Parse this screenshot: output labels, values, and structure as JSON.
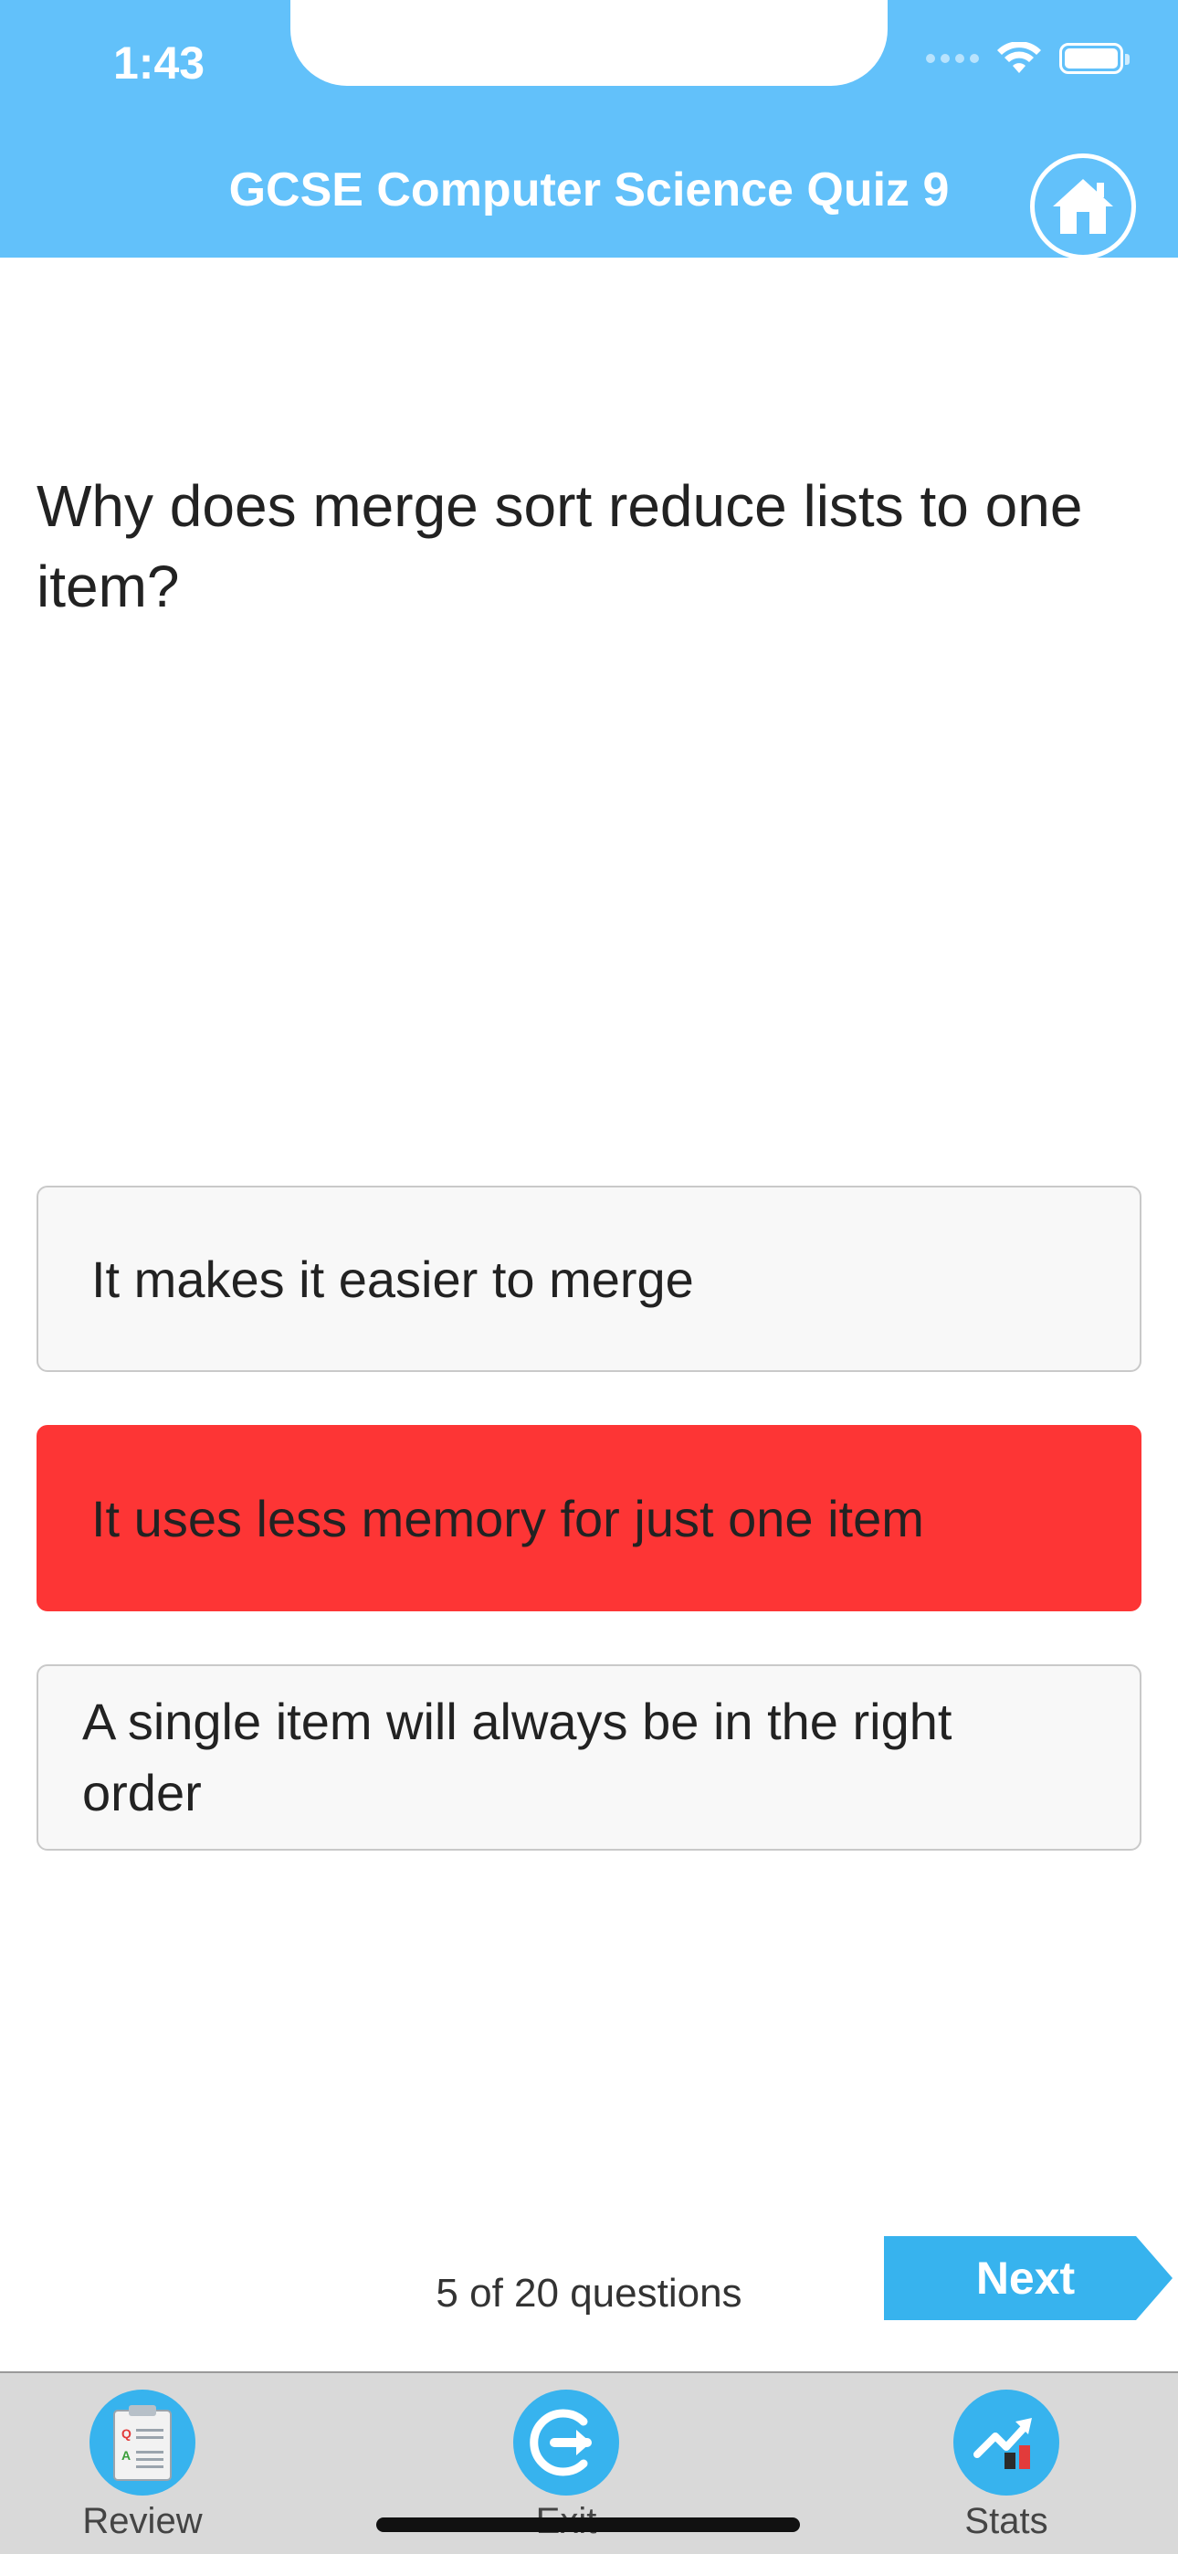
{
  "status_bar": {
    "time": "1:43"
  },
  "header": {
    "title": "GCSE Computer Science Quiz 9"
  },
  "question": {
    "text": "Why does merge sort reduce lists to one item?"
  },
  "answers": [
    {
      "text": "It makes it easier to merge",
      "state": "default"
    },
    {
      "text": "It uses less memory for just one item",
      "state": "wrong"
    },
    {
      "text": "A single item will always be in the right order",
      "state": "default"
    }
  ],
  "footer": {
    "counter": "5 of 20 questions",
    "next_label": "Next"
  },
  "tabbar": {
    "items": [
      {
        "label": "Review",
        "icon": "clipboard-icon"
      },
      {
        "label": "Exit",
        "icon": "exit-icon"
      },
      {
        "label": "Stats",
        "icon": "chart-icon"
      }
    ]
  },
  "colors": {
    "header": "#62c1fa",
    "wrong": "#fd3535",
    "accent": "#37b3ee",
    "tabbar": "#d9d9d9"
  }
}
